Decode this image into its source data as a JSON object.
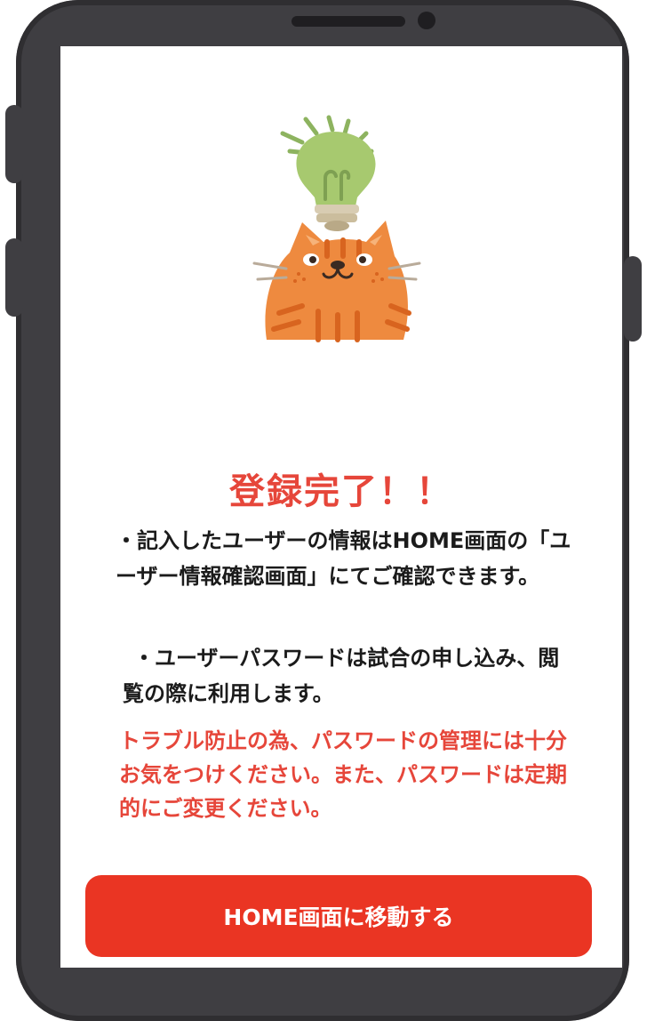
{
  "completion": {
    "title": "登録完了！！",
    "paragraph_1": "・記入したユーザーの情報はHOME画面の「ユーザー情報確認画面」にてご確認できます。",
    "paragraph_2": "・ユーザーパスワードは試合の申し込み、閲覧の際に利用します。",
    "warning": "トラブル防止の為、パスワードの管理には十分お気をつけください。また、パスワードは定期的にご変更ください。"
  },
  "actions": {
    "home_button_label": "HOME画面に移動する"
  },
  "colors": {
    "accent": "#e6463a",
    "button": "#ea3523",
    "device": "#3f3e42"
  },
  "icons": {
    "illustration": "cat-with-lightbulb-icon"
  }
}
